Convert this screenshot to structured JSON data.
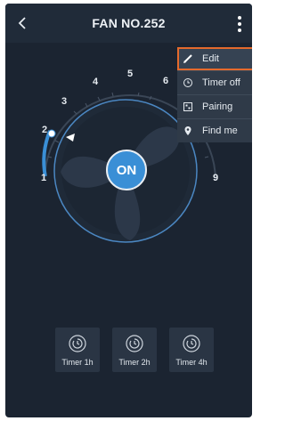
{
  "header": {
    "title": "FAN NO.252"
  },
  "dial": {
    "min_label": "1",
    "max_label": "9",
    "labels": [
      "1",
      "2",
      "3",
      "4",
      "5",
      "6",
      "9"
    ],
    "current_level": 2,
    "power_label": "ON"
  },
  "menu": {
    "items": [
      {
        "label": "Edit",
        "icon": "pencil-icon",
        "active": true
      },
      {
        "label": "Timer off",
        "icon": "clock-icon",
        "active": false
      },
      {
        "label": "Pairing",
        "icon": "pairing-icon",
        "active": false
      },
      {
        "label": "Find me",
        "icon": "location-pin-icon",
        "active": false
      }
    ]
  },
  "timers": [
    {
      "label": "Timer 1h",
      "icon": "timer-icon"
    },
    {
      "label": "Timer 2h",
      "icon": "timer-icon"
    },
    {
      "label": "Timer 4h",
      "icon": "timer-icon"
    }
  ],
  "colors": {
    "background": "#1b2431",
    "accent_blue": "#3a8fd6",
    "menu_highlight": "#e56a2c"
  }
}
